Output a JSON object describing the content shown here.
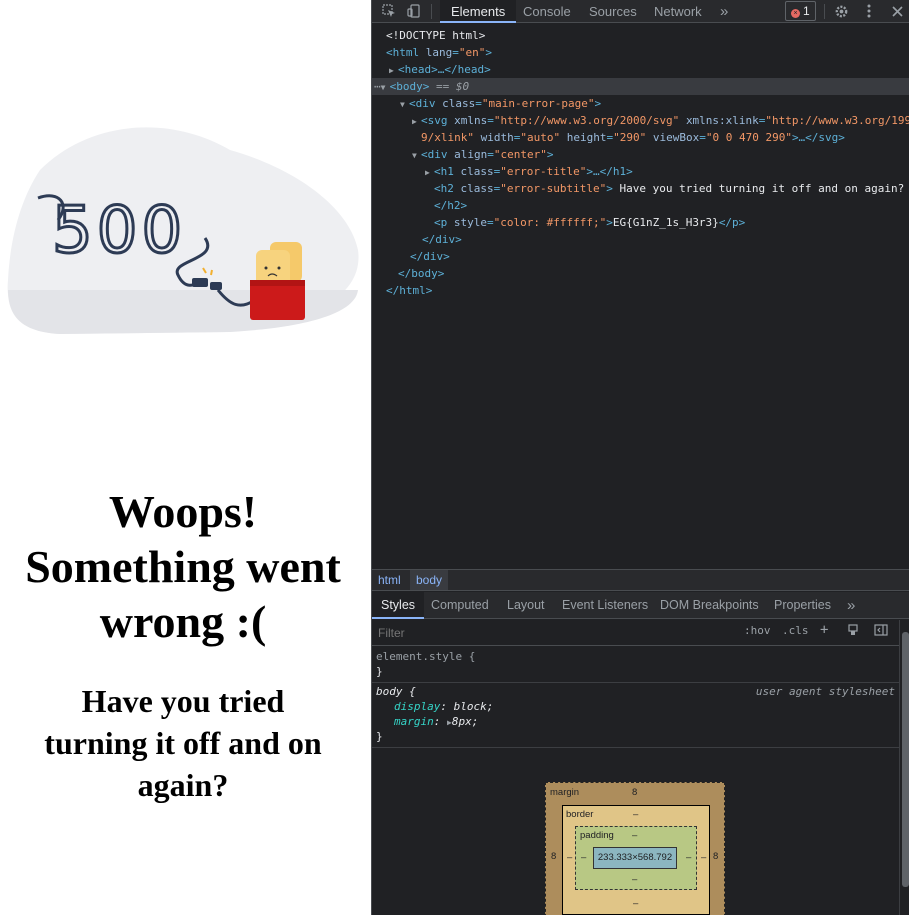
{
  "page": {
    "illustration_text": "500",
    "title_lines": [
      "Woops!",
      "Something went",
      "wrong :("
    ],
    "subtitle_lines": [
      "Have you tried",
      "turning it off and on",
      "again?"
    ],
    "hidden_text": "EG{G1nZ_1s_H3r3}"
  },
  "devtools": {
    "tabs": [
      "Elements",
      "Console",
      "Sources",
      "Network"
    ],
    "active_tab": "Elements",
    "more_tabs": "»",
    "error_count": "1",
    "dom": {
      "doctype": "<!DOCTYPE html>",
      "html_open_pre": "<html ",
      "html_lang_attr": "lang",
      "html_lang_val": "\"en\"",
      "html_open_post": ">",
      "head": "<head>…</head>",
      "body_open": "<body>",
      "body_marker": " == $0",
      "div_main_pre": "<div ",
      "class_attr": "class",
      "div_main_val": "\"main-error-page\"",
      "svg_line1_pre": "<svg ",
      "svg_xmlns": "xmlns",
      "svg_xmlns_val": "\"http://www.w3.org/2000/svg\"",
      "svg_xlink": "xmlns:xlink",
      "svg_xlink_val": "\"http://www.w3.org/199",
      "svg_line2_val": "9/xlink\"",
      "svg_width": "width",
      "svg_width_val": "\"auto\"",
      "svg_height": "height",
      "svg_height_val": "\"290\"",
      "svg_viewbox": "viewBox",
      "svg_viewbox_val": "\"0 0 470 290\"",
      "svg_close": ">…</svg>",
      "div_center_pre": "<div ",
      "align_attr": "align",
      "align_val": "\"center\"",
      "h1_pre": "<h1 ",
      "h1_val": "\"error-title\"",
      "h1_close": ">…</h1>",
      "h2_pre": "<h2 ",
      "h2_val": "\"error-subtitle\"",
      "h2_text": " Have you tried turning it off and on again?",
      "h2_end": "</h2>",
      "p_pre": "<p ",
      "style_attr": "style",
      "p_style_val": "\"color: #ffffff;\"",
      "p_text": "EG{G1nZ_1s_H3r3}",
      "p_end": "</p>",
      "div_end": "</div>",
      "body_end": "</body>",
      "html_end": "</html>"
    },
    "breadcrumbs": [
      "html",
      "body"
    ],
    "subtabs": [
      "Styles",
      "Computed",
      "Layout",
      "Event Listeners",
      "DOM Breakpoints",
      "Properties"
    ],
    "filter_placeholder": "Filter",
    "filter_tools": [
      ":hov",
      ".cls",
      "+"
    ],
    "rules": {
      "element_style": "element.style {",
      "close_brace": "}",
      "body_selector": "body {",
      "body_source": "user agent stylesheet",
      "display_prop": "display",
      "display_val": "block;",
      "margin_prop": "margin",
      "margin_val": "8px;"
    },
    "box_model": {
      "margin_label": "margin",
      "margin_top": "8",
      "margin_left": "8",
      "margin_right": "8",
      "border_label": "border",
      "border_value": "–",
      "padding_label": "padding",
      "padding_value": "–",
      "content_size": "233.333×568.792"
    }
  }
}
